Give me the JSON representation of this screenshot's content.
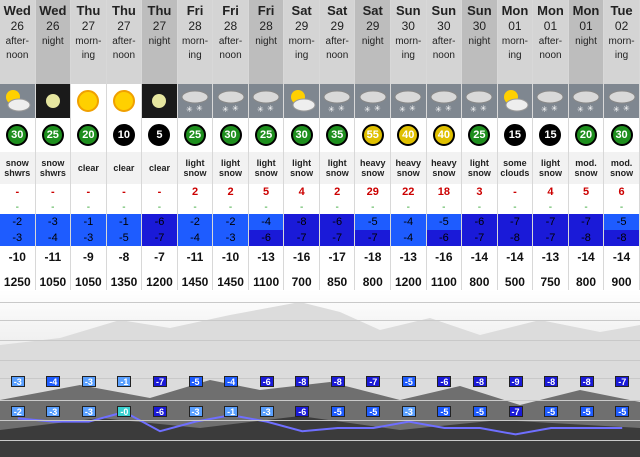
{
  "colors": {
    "header_bg": "#d4d4d4",
    "header_night_bg": "#bdbdbd",
    "temp_blue": "#1e5cff",
    "temp_dark_blue": "#1a1ad8",
    "temp_light": "#5aa0ff",
    "snow_red": "#cc0000",
    "rain_green": "#2aa02a",
    "line_color": "#6f6fff"
  },
  "columns": [
    {
      "day": "Wed",
      "date": "26",
      "period": [
        "after-",
        "noon"
      ],
      "night": false,
      "icon": "sun-cloud-icon",
      "icon_bg": "cloudy",
      "wind": "30",
      "wind_color": "#1e8f1e",
      "desc": [
        "snow",
        "shwrs"
      ],
      "snow": "-",
      "rain": "-",
      "tmax": "-2",
      "tmax_bg": "#1e5cff",
      "tmin": "-3",
      "tmin_bg": "#1e5cff",
      "chill": "-10",
      "freezing": "1250"
    },
    {
      "day": "Wed",
      "date": "26",
      "period": [
        "night"
      ],
      "night": true,
      "icon": "moon-icon",
      "icon_bg": "dark",
      "wind": "25",
      "wind_color": "#1e8f1e",
      "desc": [
        "snow",
        "shwrs"
      ],
      "snow": "-",
      "rain": "-",
      "tmax": "-3",
      "tmax_bg": "#1e5cff",
      "tmin": "-4",
      "tmin_bg": "#1e5cff",
      "chill": "-11",
      "freezing": "1050"
    },
    {
      "day": "Thu",
      "date": "27",
      "period": [
        "morn-",
        "ing"
      ],
      "night": false,
      "icon": "sun-icon",
      "icon_bg": "light",
      "wind": "20",
      "wind_color": "#1e8f1e",
      "desc": [
        "clear"
      ],
      "snow": "-",
      "rain": "-",
      "tmax": "-1",
      "tmax_bg": "#1e5cff",
      "tmin": "-3",
      "tmin_bg": "#1e5cff",
      "chill": "-9",
      "freezing": "1050"
    },
    {
      "day": "Thu",
      "date": "27",
      "period": [
        "after-",
        "noon"
      ],
      "night": false,
      "icon": "sun-icon",
      "icon_bg": "light",
      "wind": "10",
      "wind_color": "#000000",
      "desc": [
        "clear"
      ],
      "snow": "-",
      "rain": "-",
      "tmax": "-1",
      "tmax_bg": "#1e5cff",
      "tmin": "-5",
      "tmin_bg": "#1e5cff",
      "chill": "-8",
      "freezing": "1350"
    },
    {
      "day": "Thu",
      "date": "27",
      "period": [
        "night"
      ],
      "night": true,
      "icon": "moon-icon",
      "icon_bg": "dark",
      "wind": "5",
      "wind_color": "#000000",
      "desc": [
        "clear"
      ],
      "snow": "-",
      "rain": "-",
      "tmax": "-6",
      "tmax_bg": "#1a1ad8",
      "tmin": "-7",
      "tmin_bg": "#1a1ad8",
      "chill": "-7",
      "freezing": "1200"
    },
    {
      "day": "Fri",
      "date": "28",
      "period": [
        "morn-",
        "ing"
      ],
      "night": false,
      "icon": "snow-cloud-icon",
      "icon_bg": "cloudy",
      "wind": "25",
      "wind_color": "#1e8f1e",
      "desc": [
        "light",
        "snow"
      ],
      "snow": "2",
      "rain": "-",
      "tmax": "-2",
      "tmax_bg": "#1e5cff",
      "tmin": "-4",
      "tmin_bg": "#1e5cff",
      "chill": "-11",
      "freezing": "1450"
    },
    {
      "day": "Fri",
      "date": "28",
      "period": [
        "after-",
        "noon"
      ],
      "night": false,
      "icon": "snow-cloud-icon",
      "icon_bg": "cloudy",
      "wind": "30",
      "wind_color": "#1e8f1e",
      "desc": [
        "light",
        "snow"
      ],
      "snow": "2",
      "rain": "-",
      "tmax": "-2",
      "tmax_bg": "#1e5cff",
      "tmin": "-3",
      "tmin_bg": "#1e5cff",
      "chill": "-10",
      "freezing": "1450"
    },
    {
      "day": "Fri",
      "date": "28",
      "period": [
        "night"
      ],
      "night": true,
      "icon": "snow-cloud-icon",
      "icon_bg": "cloudy",
      "wind": "25",
      "wind_color": "#1e8f1e",
      "desc": [
        "light",
        "snow"
      ],
      "snow": "5",
      "rain": "-",
      "tmax": "-4",
      "tmax_bg": "#1e5cff",
      "tmin": "-6",
      "tmin_bg": "#1a1ad8",
      "chill": "-13",
      "freezing": "1100"
    },
    {
      "day": "Sat",
      "date": "29",
      "period": [
        "morn-",
        "ing"
      ],
      "night": false,
      "icon": "sun-cloud-icon",
      "icon_bg": "cloudy",
      "wind": "30",
      "wind_color": "#1e8f1e",
      "desc": [
        "light",
        "snow"
      ],
      "snow": "4",
      "rain": "-",
      "tmax": "-8",
      "tmax_bg": "#1a1ad8",
      "tmin": "-7",
      "tmin_bg": "#1a1ad8",
      "chill": "-16",
      "freezing": "700"
    },
    {
      "day": "Sat",
      "date": "29",
      "period": [
        "after-",
        "noon"
      ],
      "night": false,
      "icon": "snow-cloud-icon",
      "icon_bg": "cloudy",
      "wind": "35",
      "wind_color": "#1e8f1e",
      "desc": [
        "light",
        "snow"
      ],
      "snow": "2",
      "rain": "-",
      "tmax": "-6",
      "tmax_bg": "#1a1ad8",
      "tmin": "-7",
      "tmin_bg": "#1a1ad8",
      "chill": "-17",
      "freezing": "850"
    },
    {
      "day": "Sat",
      "date": "29",
      "period": [
        "night"
      ],
      "night": true,
      "icon": "snow-cloud-icon",
      "icon_bg": "cloudy",
      "wind": "55",
      "wind_color": "#e0c000",
      "desc": [
        "heavy",
        "snow"
      ],
      "snow": "29",
      "rain": "-",
      "tmax": "-5",
      "tmax_bg": "#1e5cff",
      "tmin": "-7",
      "tmin_bg": "#1a1ad8",
      "chill": "-18",
      "freezing": "800"
    },
    {
      "day": "Sun",
      "date": "30",
      "period": [
        "morn-",
        "ing"
      ],
      "night": false,
      "icon": "snow-cloud-icon",
      "icon_bg": "cloudy",
      "wind": "40",
      "wind_color": "#e0c000",
      "desc": [
        "heavy",
        "snow"
      ],
      "snow": "22",
      "rain": "-",
      "tmax": "-4",
      "tmax_bg": "#1e5cff",
      "tmin": "-4",
      "tmin_bg": "#1e5cff",
      "chill": "-13",
      "freezing": "1200"
    },
    {
      "day": "Sun",
      "date": "30",
      "period": [
        "after-",
        "noon"
      ],
      "night": false,
      "icon": "snow-cloud-icon",
      "icon_bg": "cloudy",
      "wind": "40",
      "wind_color": "#e0c000",
      "desc": [
        "heavy",
        "snow"
      ],
      "snow": "18",
      "rain": "-",
      "tmax": "-5",
      "tmax_bg": "#1e5cff",
      "tmin": "-6",
      "tmin_bg": "#1a1ad8",
      "chill": "-16",
      "freezing": "1100"
    },
    {
      "day": "Sun",
      "date": "30",
      "period": [
        "night"
      ],
      "night": true,
      "icon": "snow-cloud-icon",
      "icon_bg": "cloudy",
      "wind": "25",
      "wind_color": "#1e8f1e",
      "desc": [
        "light",
        "snow"
      ],
      "snow": "3",
      "rain": "-",
      "tmax": "-6",
      "tmax_bg": "#1a1ad8",
      "tmin": "-7",
      "tmin_bg": "#1a1ad8",
      "chill": "-14",
      "freezing": "800"
    },
    {
      "day": "Mon",
      "date": "01",
      "period": [
        "morn-",
        "ing"
      ],
      "night": false,
      "icon": "sun-cloud-icon",
      "icon_bg": "cloudy",
      "wind": "15",
      "wind_color": "#000000",
      "desc": [
        "some",
        "clouds"
      ],
      "snow": "-",
      "rain": "-",
      "tmax": "-7",
      "tmax_bg": "#1a1ad8",
      "tmin": "-8",
      "tmin_bg": "#1a1ad8",
      "chill": "-14",
      "freezing": "500"
    },
    {
      "day": "Mon",
      "date": "01",
      "period": [
        "after-",
        "noon"
      ],
      "night": false,
      "icon": "snow-cloud-icon",
      "icon_bg": "cloudy",
      "wind": "15",
      "wind_color": "#000000",
      "desc": [
        "light",
        "snow"
      ],
      "snow": "4",
      "rain": "-",
      "tmax": "-7",
      "tmax_bg": "#1a1ad8",
      "tmin": "-7",
      "tmin_bg": "#1a1ad8",
      "chill": "-13",
      "freezing": "750"
    },
    {
      "day": "Mon",
      "date": "01",
      "period": [
        "night"
      ],
      "night": true,
      "icon": "snow-cloud-icon",
      "icon_bg": "cloudy",
      "wind": "20",
      "wind_color": "#1e8f1e",
      "desc": [
        "mod.",
        "snow"
      ],
      "snow": "5",
      "rain": "-",
      "tmax": "-7",
      "tmax_bg": "#1a1ad8",
      "tmin": "-8",
      "tmin_bg": "#1a1ad8",
      "chill": "-14",
      "freezing": "800"
    },
    {
      "day": "Tue",
      "date": "02",
      "period": [
        "morn-",
        "ing"
      ],
      "night": false,
      "icon": "snow-cloud-icon",
      "icon_bg": "cloudy",
      "wind": "30",
      "wind_color": "#1e8f1e",
      "desc": [
        "mod.",
        "snow"
      ],
      "snow": "6",
      "rain": "-",
      "tmax": "-5",
      "tmax_bg": "#1e5cff",
      "tmin": "-8",
      "tmin_bg": "#1a1ad8",
      "chill": "-14",
      "freezing": "900"
    }
  ],
  "graph": {
    "upper_labels": [
      "-3",
      "-4",
      "-3",
      "-1",
      "-7",
      "-5",
      "-4",
      "-6",
      "-8",
      "-8",
      "-7",
      "-5",
      "-6",
      "-8",
      "-9",
      "-8",
      "-8",
      "-7"
    ],
    "lower_labels": [
      "-2",
      "-3",
      "-3",
      "-0",
      "-6",
      "-3",
      "-1",
      "-3",
      "-6",
      "-5",
      "-5",
      "-3",
      "-5",
      "-5",
      "-7",
      "-5",
      "-5",
      "-5"
    ],
    "lower_values": [
      -2,
      -3,
      -3,
      0,
      -6,
      -3,
      -1,
      -3,
      -6,
      -5,
      -5,
      -3,
      -5,
      -5,
      -7,
      -5,
      -5,
      -5
    ]
  }
}
